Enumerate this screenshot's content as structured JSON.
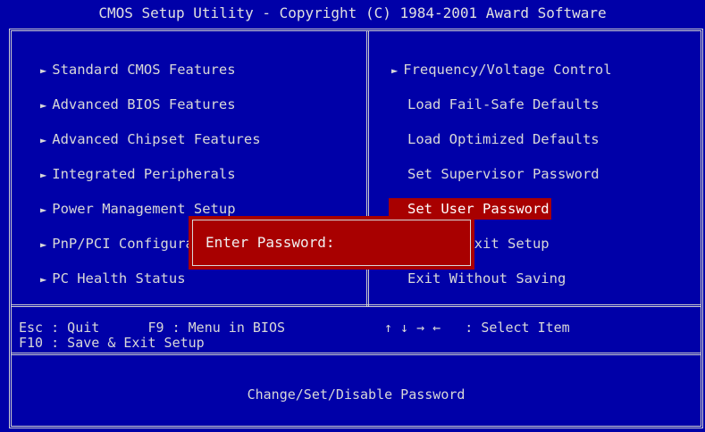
{
  "window": {
    "title": "CMOS Setup Utility - Copyright (C) 1984-2001 Award Software"
  },
  "menu": {
    "left": [
      {
        "label": "Standard CMOS Features",
        "has_submenu": true
      },
      {
        "label": "Advanced BIOS Features",
        "has_submenu": true
      },
      {
        "label": "Advanced Chipset Features",
        "has_submenu": true
      },
      {
        "label": "Integrated Peripherals",
        "has_submenu": true
      },
      {
        "label": "Power Management Setup",
        "has_submenu": true
      },
      {
        "label": "PnP/PCI Configuration",
        "has_submenu": true
      },
      {
        "label": "PC Health Status",
        "has_submenu": true
      }
    ],
    "right": [
      {
        "label": "Frequency/Voltage Control",
        "has_submenu": true
      },
      {
        "label": "Load Fail-Safe Defaults",
        "has_submenu": false
      },
      {
        "label": "Load Optimized Defaults",
        "has_submenu": false
      },
      {
        "label": "Set Supervisor Password",
        "has_submenu": false
      },
      {
        "label": "Set User Password",
        "has_submenu": false,
        "selected": true
      },
      {
        "label": "Save & Exit Setup",
        "has_submenu": false
      },
      {
        "label": "Exit Without Saving",
        "has_submenu": false
      }
    ],
    "arrow_glyph": "►"
  },
  "status": {
    "line1_left": "Esc : Quit      F9 : Menu in BIOS",
    "line1_right": "↑ ↓ → ←   : Select Item",
    "line2_left": "F10 : Save & Exit Setup"
  },
  "help": {
    "text": "Change/Set/Disable Password"
  },
  "dialog": {
    "label": "Enter Password:",
    "value": ""
  },
  "colors": {
    "background": "#0000a8",
    "highlight": "#a80000",
    "text": "#d8d8d8"
  }
}
